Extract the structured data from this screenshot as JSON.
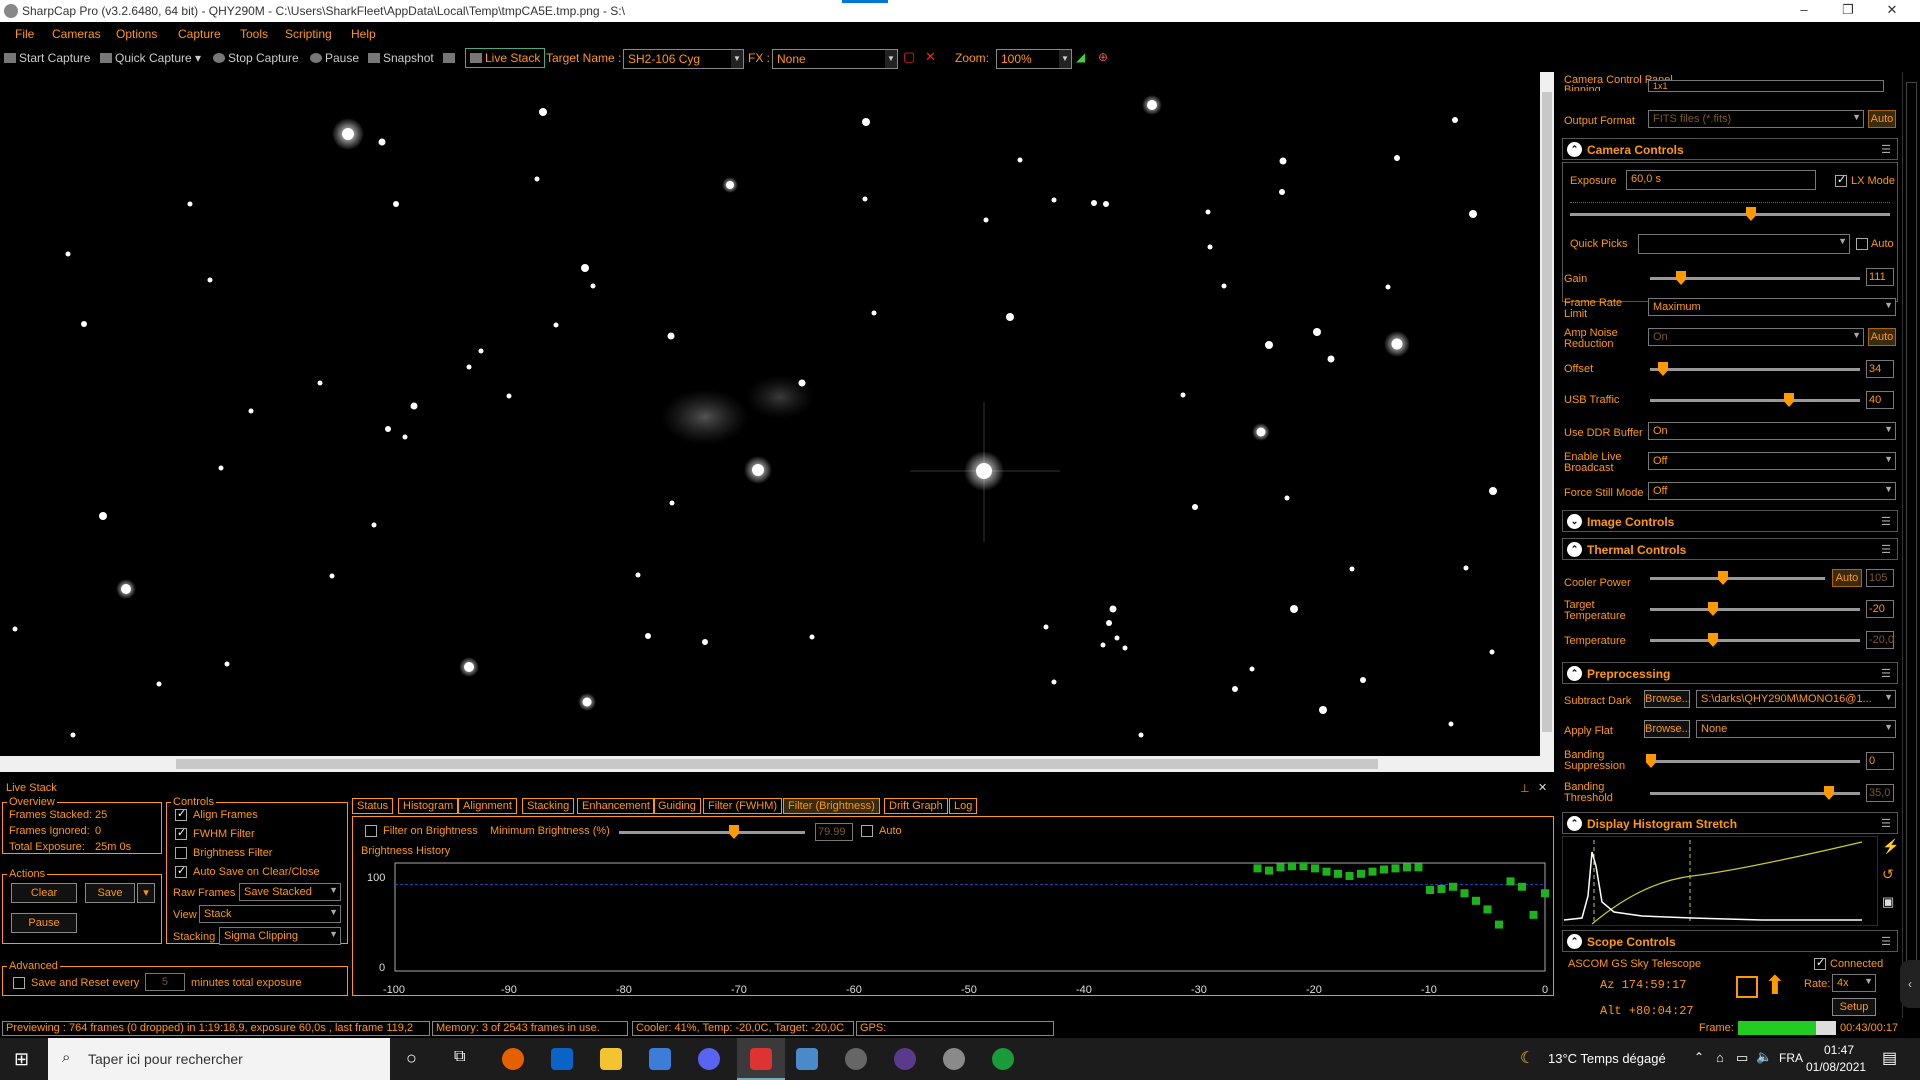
{
  "window": {
    "title": "SharpCap Pro (v3.2.6480, 64 bit) - QHY290M - C:\\Users\\SharkFleet\\AppData\\Local\\Temp\\tmpCA5E.tmp.png - S:\\"
  },
  "menu": [
    "File",
    "Cameras",
    "Options",
    "Capture",
    "Tools",
    "Scripting",
    "Help"
  ],
  "toolbar": {
    "start_capture": "Start Capture",
    "quick_capture": "Quick Capture",
    "stop_capture": "Stop Capture",
    "pause": "Pause",
    "snapshot": "Snapshot",
    "live_stack": "Live Stack",
    "target_label": "Target Name :",
    "target_value": "SH2-106 Cyg",
    "fx_label": "FX :",
    "fx_value": "None",
    "zoom_label": "Zoom:",
    "zoom_value": "100%"
  },
  "panel": {
    "title": "Camera Control Panel",
    "binning_label": "Binning",
    "binning_value": "1x1",
    "output_format_label": "Output Format",
    "output_format_value": "FITS files (*.fits)",
    "auto": "Auto",
    "camera_controls": "Camera Controls",
    "exposure_label": "Exposure",
    "exposure_value": "60,0 s",
    "lx_mode": "LX Mode",
    "quick_picks": "Quick Picks",
    "gain_label": "Gain",
    "gain_value": "111",
    "frame_rate_label": "Frame Rate Limit",
    "frame_rate_value": "Maximum",
    "amp_noise_label": "Amp Noise Reduction",
    "amp_noise_value": "On",
    "offset_label": "Offset",
    "offset_value": "34",
    "usb_label": "USB Traffic",
    "usb_value": "40",
    "ddr_label": "Use DDR Buffer",
    "ddr_value": "On",
    "live_broadcast_label": "Enable Live Broadcast",
    "live_broadcast_value": "Off",
    "force_still_label": "Force Still Mode",
    "force_still_value": "Off",
    "image_controls": "Image Controls",
    "thermal_controls": "Thermal Controls",
    "cooler_power_label": "Cooler Power",
    "cooler_power_value": "105",
    "target_temp_label": "Target Temperature",
    "target_temp_value": "-20",
    "temperature_label": "Temperature",
    "temperature_value": "-20,0",
    "preprocessing": "Preprocessing",
    "subtract_dark_label": "Subtract Dark",
    "browse": "Browse...",
    "subtract_dark_value": "S:\\darks\\QHY290M\\MONO16@1...",
    "apply_flat_label": "Apply Flat",
    "apply_flat_value": "None",
    "banding_supp_label": "Banding Suppression",
    "banding_supp_value": "0",
    "banding_thresh_label": "Banding Threshold",
    "banding_thresh_value": "35,0",
    "histogram_stretch": "Display Histogram Stretch",
    "scope_controls": "Scope Controls",
    "scope_name": "ASCOM GS Sky Telescope",
    "connected": "Connected",
    "az": "Az  174:59:17",
    "alt": "Alt +80:04:27",
    "rate_label": "Rate:",
    "rate_value": "4x",
    "setup": "Setup"
  },
  "livestack": {
    "title": "Live Stack",
    "overview": "Overview",
    "frames_stacked_label": "Frames Stacked:",
    "frames_stacked": "25",
    "frames_ignored_label": "Frames Ignored:",
    "frames_ignored": "0",
    "total_exposure_label": "Total Exposure:",
    "total_exposure": "25m 0s",
    "actions": "Actions",
    "clear": "Clear",
    "save": "Save",
    "pause": "Pause",
    "controls": "Controls",
    "align_frames": "Align Frames",
    "fwhm_filter": "FWHM Filter",
    "brightness_filter": "Brightness Filter",
    "auto_save": "Auto Save on Clear/Close",
    "raw_frames_label": "Raw Frames",
    "raw_frames_value": "Save Stacked",
    "view_label": "View",
    "view_value": "Stack",
    "stacking_label": "Stacking",
    "stacking_value": "Sigma Clipping",
    "advanced": "Advanced",
    "save_reset": "Save and Reset every",
    "save_reset_value": "5",
    "minutes": "minutes total exposure",
    "tabs": [
      "Status",
      "Histogram",
      "Alignment",
      "Stacking",
      "Enhancement",
      "Guiding",
      "Filter (FWHM)",
      "Filter (Brightness)",
      "Drift Graph",
      "Log"
    ],
    "filter_on_brightness": "Filter on Brightness",
    "min_brightness_label": "Minimum Brightness (%)",
    "min_brightness_value": "79.99",
    "auto": "Auto",
    "history_title": "Brightness History",
    "y_max": "100",
    "y_min": "0",
    "x_ticks": [
      "-100",
      "-90",
      "-80",
      "-70",
      "-60",
      "-50",
      "-40",
      "-30",
      "-20",
      "-10",
      "0"
    ]
  },
  "chart_data": {
    "type": "scatter",
    "title": "Brightness History",
    "xlim": [
      -100,
      0
    ],
    "ylim": [
      0,
      100
    ],
    "threshold": 79.99,
    "x": [
      -25,
      -24,
      -23,
      -22,
      -21,
      -20,
      -19,
      -18,
      -17,
      -16,
      -15,
      -14,
      -13,
      -12,
      -11,
      -10,
      -9,
      -8,
      -7,
      -6,
      -5,
      -4,
      -3,
      -2,
      -1,
      0
    ],
    "y": [
      95,
      93,
      96,
      97,
      97,
      95,
      92,
      90,
      88,
      90,
      92,
      94,
      95,
      96,
      96,
      75,
      76,
      78,
      72,
      65,
      57,
      43,
      83,
      78,
      52,
      72
    ]
  },
  "status": {
    "previewing": "Previewing : 764 frames (0 dropped) in 1:19:18,9, exposure 60,0s , last frame 119,2",
    "memory": "Memory: 3 of 2543 frames in use.",
    "cooler": "Cooler: 41%, Temp: -20,0C, Target: -20,0C",
    "gps": "GPS:",
    "frame_label": "Frame:",
    "frame_time": "00:43/00:17"
  },
  "taskbar": {
    "search_placeholder": "Taper ici pour rechercher",
    "weather": "13°C  Temps dégagé",
    "lang": "FRA",
    "time": "01:47",
    "date": "01/08/2021"
  }
}
